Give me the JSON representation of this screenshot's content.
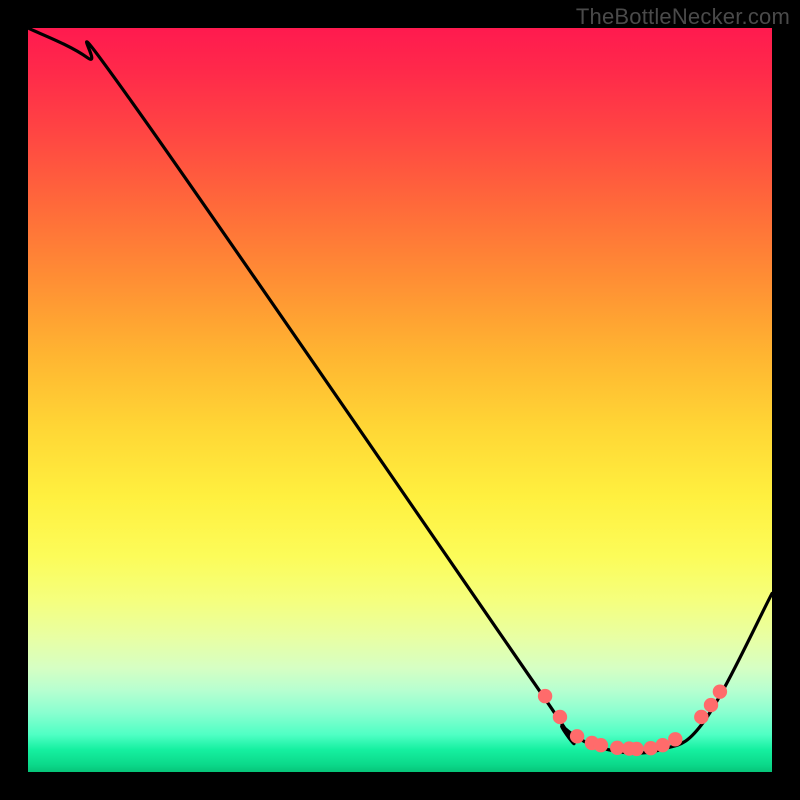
{
  "watermark": "TheBottleNecker.com",
  "chart_data": {
    "type": "line",
    "title": "",
    "xlabel": "",
    "ylabel": "",
    "xlim": [
      0,
      100
    ],
    "ylim": [
      0,
      100
    ],
    "series": [
      {
        "name": "curve",
        "points": [
          {
            "x": 0,
            "y": 100
          },
          {
            "x": 8,
            "y": 96
          },
          {
            "x": 14,
            "y": 90
          },
          {
            "x": 68,
            "y": 12
          },
          {
            "x": 72,
            "y": 6
          },
          {
            "x": 78,
            "y": 3
          },
          {
            "x": 85,
            "y": 3
          },
          {
            "x": 91,
            "y": 7
          },
          {
            "x": 100,
            "y": 24
          }
        ]
      }
    ],
    "markers": [
      {
        "x": 69.5,
        "y": 10.2
      },
      {
        "x": 71.5,
        "y": 7.4
      },
      {
        "x": 73.8,
        "y": 4.8
      },
      {
        "x": 75.8,
        "y": 3.9
      },
      {
        "x": 77.0,
        "y": 3.6
      },
      {
        "x": 79.2,
        "y": 3.25
      },
      {
        "x": 80.8,
        "y": 3.15
      },
      {
        "x": 81.8,
        "y": 3.1
      },
      {
        "x": 83.7,
        "y": 3.2
      },
      {
        "x": 85.3,
        "y": 3.6
      },
      {
        "x": 87.0,
        "y": 4.4
      },
      {
        "x": 90.5,
        "y": 7.4
      },
      {
        "x": 91.8,
        "y": 9.0
      },
      {
        "x": 93.0,
        "y": 10.8
      }
    ],
    "gradient_stops": [
      {
        "pos": 0,
        "color": "#ff1a4f"
      },
      {
        "pos": 50,
        "color": "#ffd735"
      },
      {
        "pos": 100,
        "color": "#06c479"
      }
    ]
  }
}
